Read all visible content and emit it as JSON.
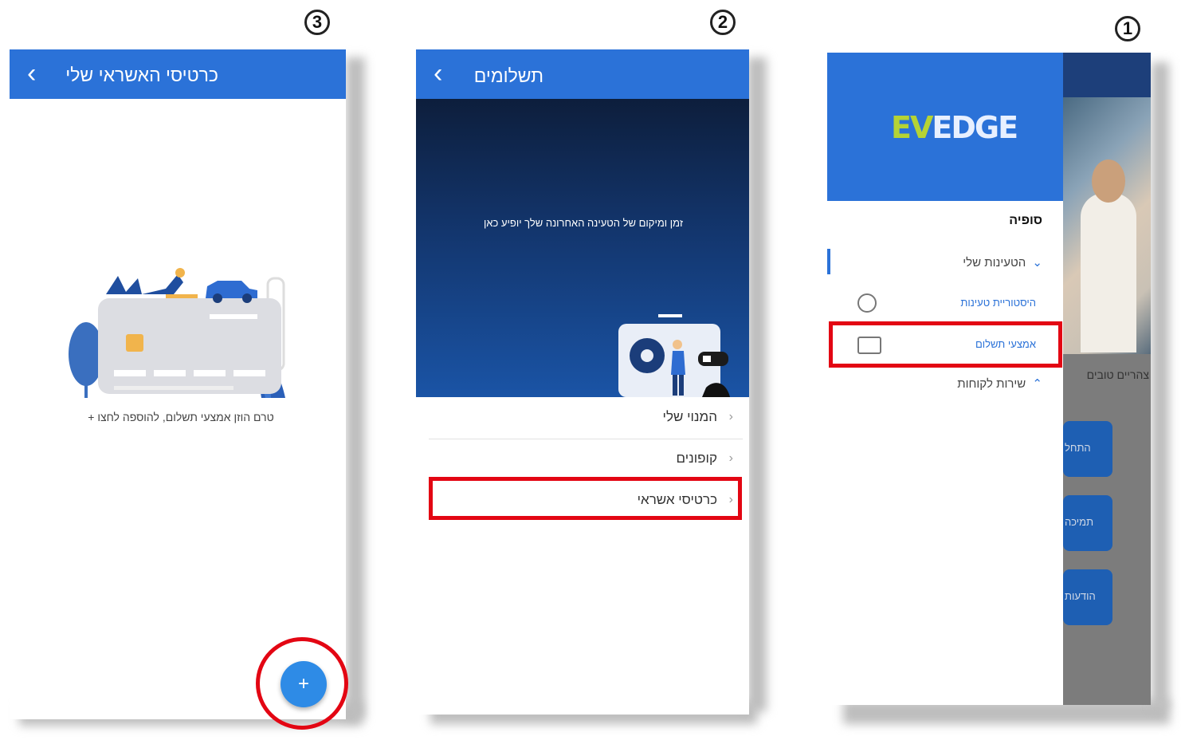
{
  "steps": [
    "1",
    "2",
    "3"
  ],
  "screen1": {
    "logo_ev": "EV",
    "logo_edge": "EDGE",
    "user_name": "סופיה",
    "menu": {
      "my_charges": "הטעינות שלי",
      "charge_history": "היסטוריית טעינות",
      "payment_methods": "אמצעי תשלום",
      "customer_service": "שירות לקוחות"
    },
    "bg_text": "צהריים טובים",
    "bg_buttons": [
      "התחל",
      "תמיכה",
      "הודעות"
    ],
    "colors": {
      "brand_blue": "#2b72d8",
      "logo_green": "#b5d334",
      "logo_white": "#e8f0ff"
    }
  },
  "screen2": {
    "title": "תשלומים",
    "hero_text": "זמן ומיקום של הטעינה האחרונה שלך יופיע כאן",
    "items": [
      "המנוי שלי",
      "קופונים",
      "כרטיסי אשראי"
    ]
  },
  "screen3": {
    "title": "כרטיסי האשראי שלי",
    "empty_text": "טרם הוזן אמצעי תשלום, להוספה לחצו +",
    "fab_label": "+",
    "colors": {
      "fab": "#2e8be6",
      "highlight": "#e30613"
    }
  }
}
